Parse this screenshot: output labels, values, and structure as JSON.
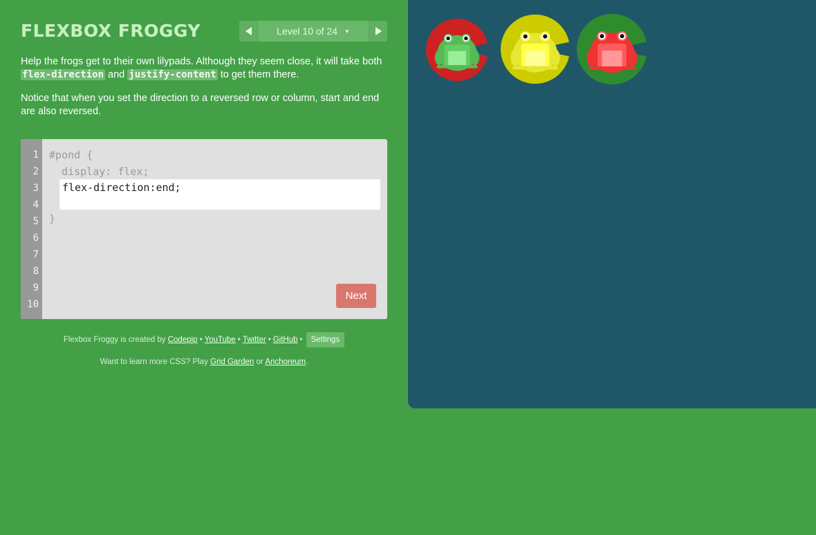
{
  "app": {
    "logo": "FLEXBOX FROGGY"
  },
  "level_nav": {
    "label": "Level 10 of 24"
  },
  "instructions": {
    "p1_before": "Help the frogs get to their own lilypads. Although they seem close, it will take both ",
    "code1": "flex-direction",
    "and": " and ",
    "code2": "justify-content",
    "p1_after": " to get them there.",
    "p2": "Notice that when you set the direction to a reversed row or column, start and end are also reversed."
  },
  "editor": {
    "line_numbers": [
      "1",
      "2",
      "3",
      "4",
      "5",
      "6",
      "7",
      "8",
      "9",
      "10"
    ],
    "line1": "#pond {",
    "line2": "  display: flex;",
    "input_value": "flex-direction:end;",
    "line5": "}",
    "next_label": "Next"
  },
  "credits": {
    "prefix": "Flexbox Froggy is created by",
    "links": [
      "Codepip",
      "YouTube",
      "Twitter",
      "GitHub"
    ],
    "separator": "•",
    "settings_label": "Settings"
  },
  "learn_more": {
    "prefix": "Want to learn more CSS? Play",
    "link1": "Grid Garden",
    "middle": "or",
    "link2": "Anchoreum",
    "suffix": "."
  },
  "pond": {
    "lilypads": [
      {
        "color": "red",
        "pad": "#cc2222",
        "frog": "#66cc66"
      },
      {
        "color": "yellow",
        "pad": "#cccc00",
        "frog": "#ffff44"
      },
      {
        "color": "green",
        "pad": "#2e8b2e",
        "frog": "#ff5b5b"
      }
    ]
  }
}
